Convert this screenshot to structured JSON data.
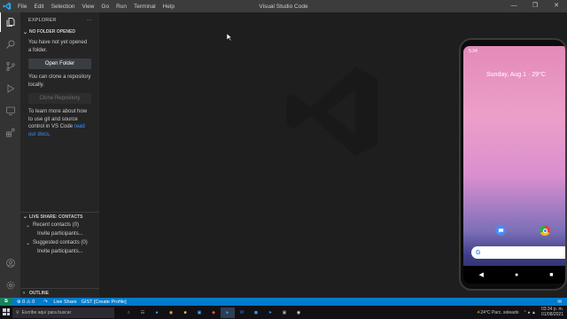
{
  "window": {
    "title": "Visual Studio Code",
    "menu": [
      "File",
      "Edit",
      "Selection",
      "View",
      "Go",
      "Run",
      "Terminal",
      "Help"
    ]
  },
  "sidebar": {
    "header": "EXPLORER",
    "no_folder": {
      "title": "NO FOLDER OPENED",
      "message": "You have not yet opened a folder.",
      "open_button": "Open Folder",
      "clone_message": "You can clone a repository locally.",
      "clone_button": "Clone Repository",
      "learn_text": "To learn more about how to use git and source control in VS Code ",
      "learn_link": "read our docs",
      "learn_end": "."
    },
    "live_share": {
      "title": "LIVE SHARE: CONTACTS",
      "recent": "Recent contacts (0)",
      "recent_invite": "Invite participants...",
      "suggested": "Suggested contacts (0)",
      "suggested_invite": "Invite participants..."
    },
    "outline": "OUTLINE"
  },
  "statusbar": {
    "problems": "⊗ 0 ⚠ 0",
    "liveshare": "Live Share",
    "gist": "GIST [Create Profile]"
  },
  "phone": {
    "status_time": "5:34",
    "date": "Sunday, Aug 1  · 29°C",
    "search_g": "G"
  },
  "taskbar": {
    "search_placeholder": "Escribe aquí para buscar",
    "weather": "24°C  Parc. soleado",
    "time": "03:34 p. m.",
    "date": "01/08/2021"
  },
  "colors": {
    "accent": "#007acc",
    "link": "#3794ff"
  }
}
